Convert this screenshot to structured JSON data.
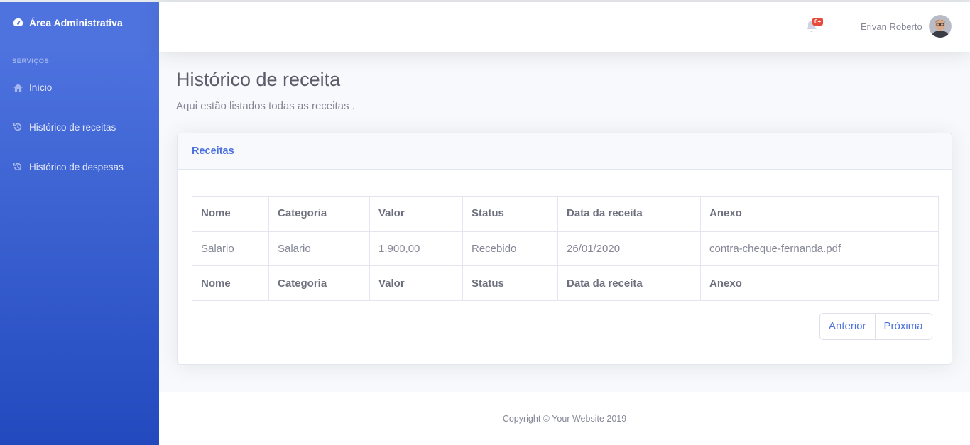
{
  "sidebar": {
    "brand": "Área Administrativa",
    "brand_icon": "tachometer-icon",
    "section_heading": "SERVIÇOS",
    "items": [
      {
        "label": "Início",
        "icon": "home-icon"
      },
      {
        "label": "Histórico de receitas",
        "icon": "history-icon"
      },
      {
        "label": "Histórico de despesas",
        "icon": "history-icon"
      }
    ]
  },
  "topbar": {
    "alerts_badge": "0+",
    "user_name": "Erivan Roberto"
  },
  "page": {
    "title": "Histórico de receita",
    "subtitle": "Aqui estão listados todas as receitas ."
  },
  "card": {
    "title": "Receitas",
    "columns": [
      "Nome",
      "Categoria",
      "Valor",
      "Status",
      "Data da receita",
      "Anexo"
    ],
    "rows": [
      [
        "Salario",
        "Salario",
        "1.900,00",
        "Recebido",
        "26/01/2020",
        "contra-cheque-fernanda.pdf"
      ]
    ],
    "pagination": {
      "prev": "Anterior",
      "next": "Próxima"
    }
  },
  "footer": {
    "copyright": "Copyright © Your Website 2019"
  },
  "colors": {
    "primary": "#4e73df",
    "sidebar_bottom": "#224abe",
    "danger": "#e74a3b"
  }
}
